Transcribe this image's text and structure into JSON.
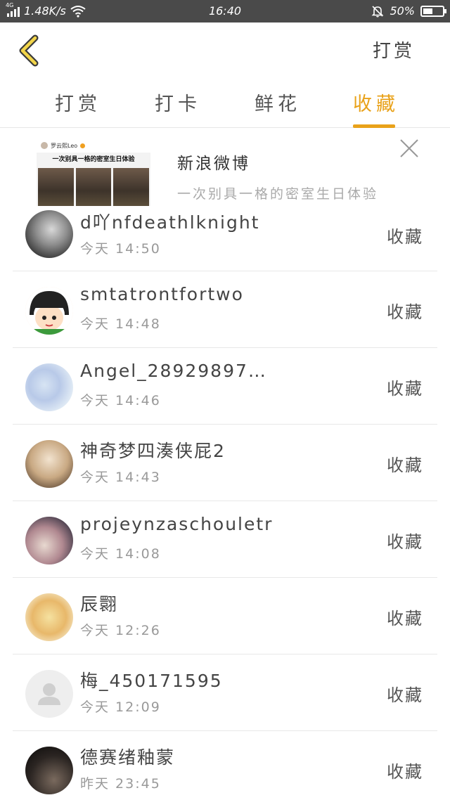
{
  "status_bar": {
    "network": "4G",
    "speed": "1.48K/s",
    "time": "16:40",
    "battery": "50%",
    "battery_level": 0.5
  },
  "header": {
    "action_label": "打赏"
  },
  "tabs": [
    {
      "label": "打赏",
      "active": false
    },
    {
      "label": "打卡",
      "active": false
    },
    {
      "label": "鲜花",
      "active": false
    },
    {
      "label": "收藏",
      "active": true
    }
  ],
  "accent_color": "#e9a21a",
  "ad": {
    "title": "新浪微博",
    "subtitle": "一次别具一格的密室生日体验",
    "thumb_caption": "一次别具一格的密室生日体验",
    "thumb_user": "罗云熙Leo"
  },
  "list": [
    {
      "name": "d吖nfdeathlknight",
      "time": "今天 14:50",
      "action": "收藏"
    },
    {
      "name": "smtatrontfortwo",
      "time": "今天 14:48",
      "action": "收藏"
    },
    {
      "name": "Angel_28929897…",
      "time": "今天 14:46",
      "action": "收藏"
    },
    {
      "name": "神奇梦四湊侠屁2",
      "time": "今天 14:43",
      "action": "收藏"
    },
    {
      "name": "projeynzaschouletr",
      "time": "今天 14:08",
      "action": "收藏"
    },
    {
      "name": "辰翾",
      "time": "今天 12:26",
      "action": "收藏"
    },
    {
      "name": "梅_450171595",
      "time": "今天 12:09",
      "action": "收藏"
    },
    {
      "name": "德赛绪釉蒙",
      "time": "昨天 23:45",
      "action": "收藏"
    }
  ]
}
